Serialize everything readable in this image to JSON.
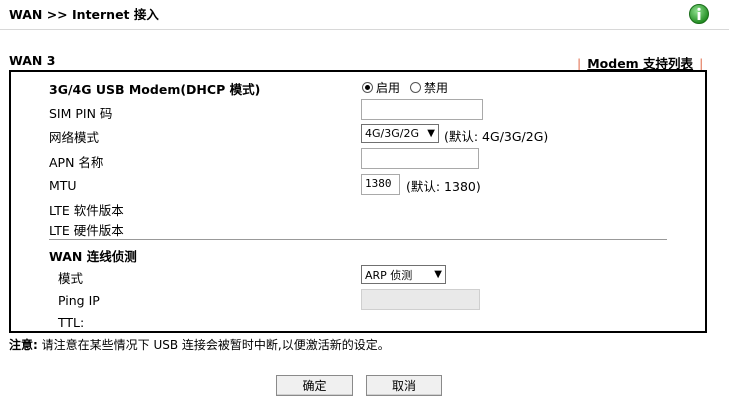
{
  "header": {
    "breadcrumb": "WAN >> Internet 接入"
  },
  "section": {
    "title": "WAN 3",
    "modem_link": "Modem 支持列表",
    "pipe_left": "|",
    "pipe_right": "|"
  },
  "form": {
    "modem_label": "3G/4G USB Modem(DHCP 模式)",
    "enable_label": "启用",
    "disable_label": "禁用",
    "enabled": true,
    "sim_pin_label": "SIM PIN 码",
    "sim_pin_value": "",
    "network_mode_label": "网络模式",
    "network_mode_value": "4G/3G/2G",
    "network_mode_hint": "(默认: 4G/3G/2G)",
    "apn_label": "APN 名称",
    "apn_value": "",
    "mtu_label": "MTU",
    "mtu_value": "1380",
    "mtu_hint": "(默认: 1380)",
    "lte_sw_label": "LTE 软件版本",
    "lte_hw_label": "LTE 硬件版本",
    "detect_title": "WAN 连线侦测",
    "detect_mode_label": "模式",
    "detect_mode_value": "ARP 侦测",
    "ping_ip_label": "Ping IP",
    "ping_ip_value": "",
    "ttl_label": "TTL:"
  },
  "note": {
    "prefix": "注意:",
    "text": " 请注意在某些情况下 USB 连接会被暂时中断,以便激活新的设定。"
  },
  "buttons": {
    "ok": "确定",
    "cancel": "取消"
  },
  "colors": {
    "help_icon": "#2e9b2e",
    "pipe": "#e07050"
  }
}
